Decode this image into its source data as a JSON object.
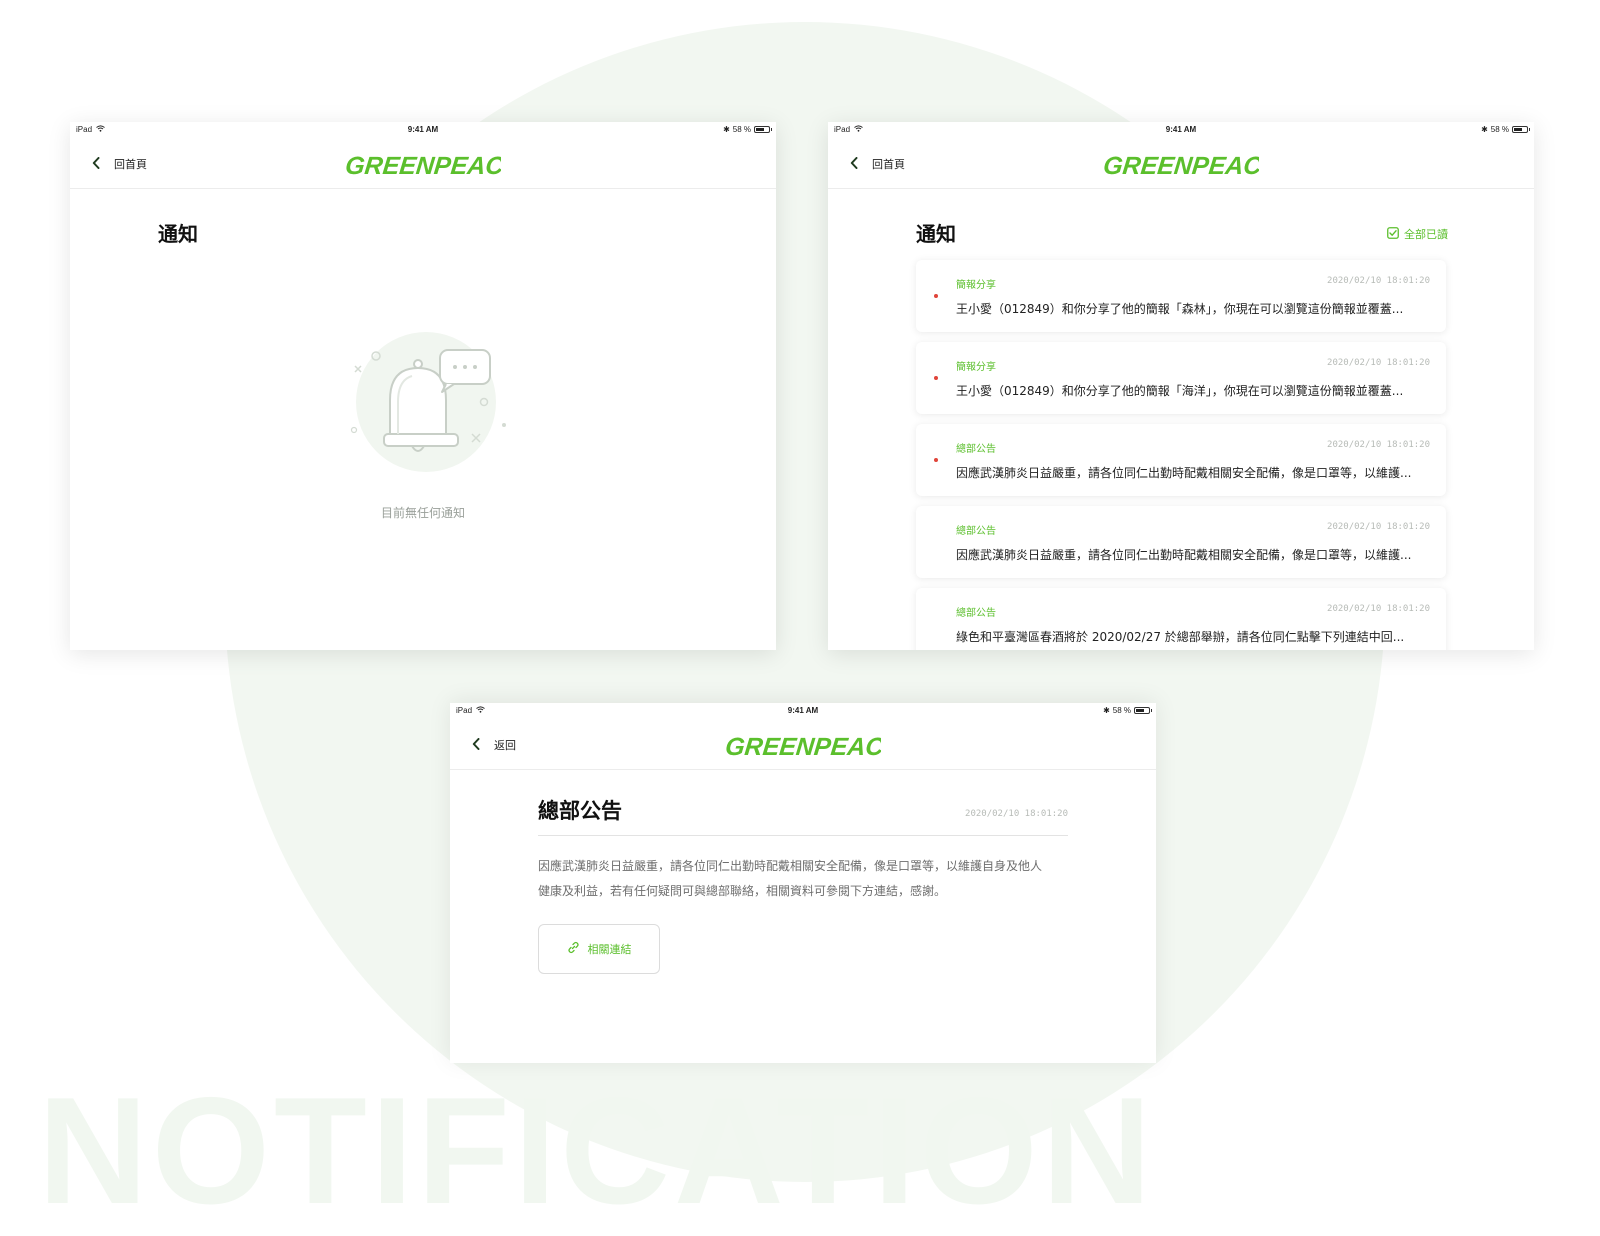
{
  "background": {
    "watermark": "NOTIFICATION"
  },
  "colors": {
    "brand_green": "#5bbf2c",
    "unread_dot": "#e0443a",
    "muted": "#9aa09a"
  },
  "device_status": {
    "device": "iPad",
    "time": "9:41 AM",
    "battery": "58 %"
  },
  "brand": {
    "logo_text": "GREENPEACE"
  },
  "screen_empty": {
    "back_label": "回首頁",
    "title": "通知",
    "empty_text": "目前無任何通知"
  },
  "screen_list": {
    "back_label": "回首頁",
    "title": "通知",
    "mark_all_read": "全部已讀",
    "notifications": [
      {
        "category": "簡報分享",
        "time": "2020/02/10 18:01:20",
        "message": "王小愛（012849）和你分享了他的簡報「森林」，你現在可以瀏覽這份簡報並覆蓋...",
        "unread": true
      },
      {
        "category": "簡報分享",
        "time": "2020/02/10 18:01:20",
        "message": "王小愛（012849）和你分享了他的簡報「海洋」，你現在可以瀏覽這份簡報並覆蓋...",
        "unread": true
      },
      {
        "category": "總部公告",
        "time": "2020/02/10 18:01:20",
        "message": "因應武漢肺炎日益嚴重，請各位同仁出勤時配戴相關安全配備，像是口罩等，以維護...",
        "unread": true
      },
      {
        "category": "總部公告",
        "time": "2020/02/10 18:01:20",
        "message": "因應武漢肺炎日益嚴重，請各位同仁出勤時配戴相關安全配備，像是口罩等，以維護...",
        "unread": false
      },
      {
        "category": "總部公告",
        "time": "2020/02/10 18:01:20",
        "message": "綠色和平臺灣區春酒將於 2020/02/27 於總部舉辦，請各位同仁點擊下列連結中回...",
        "unread": false
      }
    ]
  },
  "screen_detail": {
    "back_label": "返回",
    "title": "總部公告",
    "time": "2020/02/10 18:01:20",
    "body_line1": "因應武漢肺炎日益嚴重，請各位同仁出勤時配戴相關安全配備，像是口罩等，以維護自身及他人",
    "body_line2": "健康及利益，若有任何疑問可與總部聯絡，相關資料可參閱下方連結，感謝。",
    "link_label": "相關連結"
  }
}
